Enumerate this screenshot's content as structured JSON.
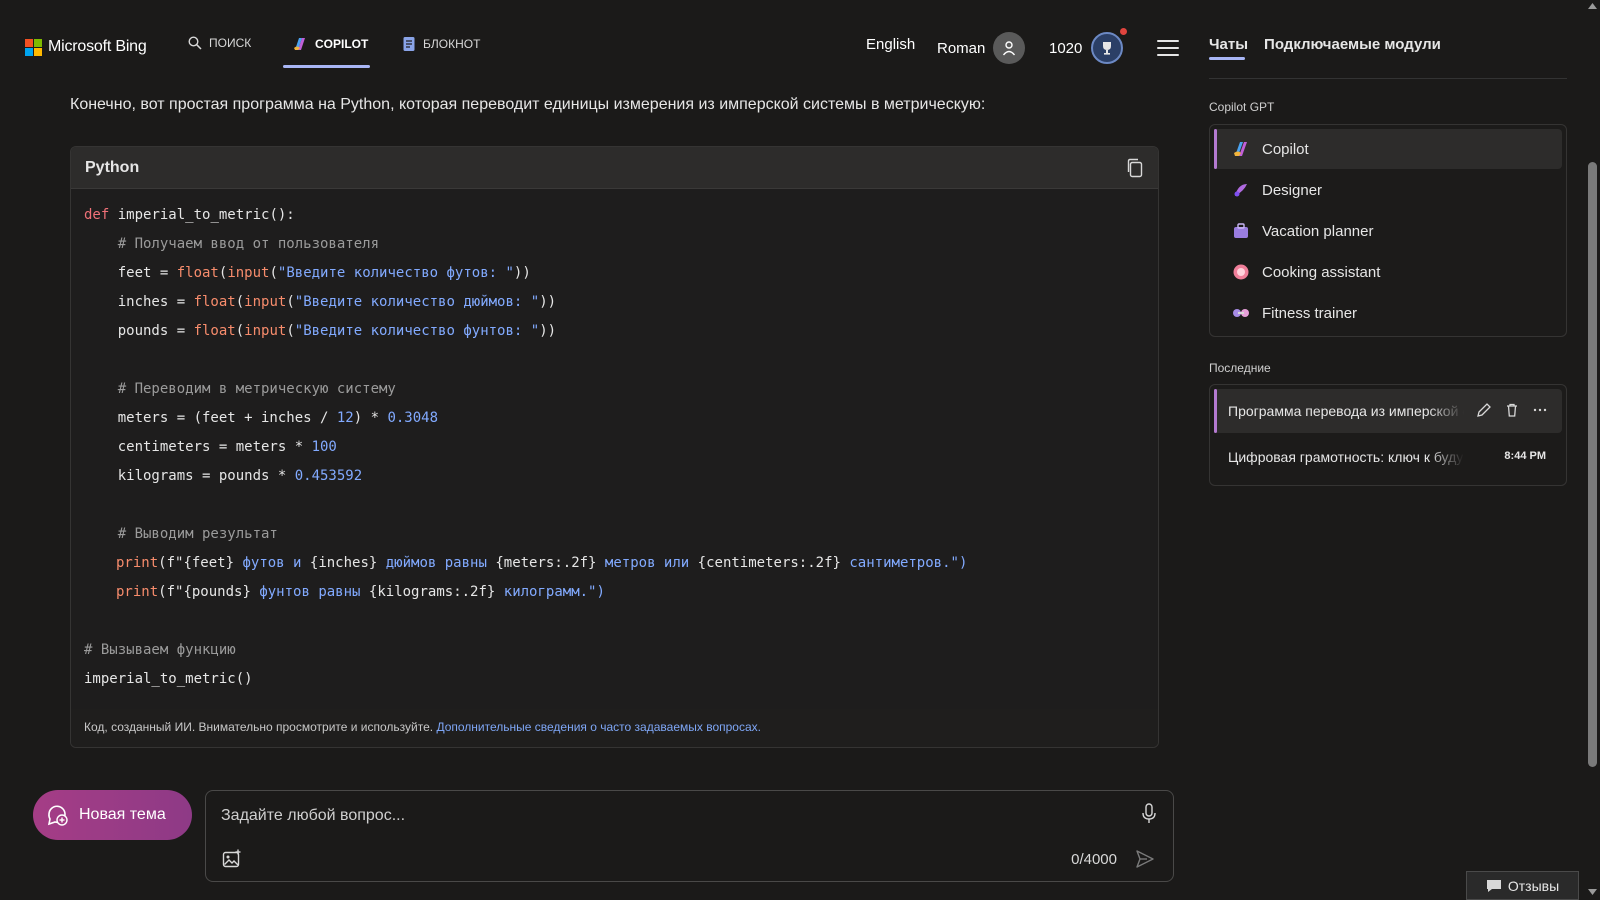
{
  "header": {
    "logo_text": "Microsoft Bing",
    "nav": [
      {
        "label": "ПОИСК",
        "icon": "search-icon"
      },
      {
        "label": "COPILOT",
        "icon": "copilot-icon",
        "active": true
      },
      {
        "label": "БЛОКНОТ",
        "icon": "notebook-icon"
      }
    ],
    "language": "English",
    "user_name": "Roman",
    "points": "1020"
  },
  "chat": {
    "intro_text": "Конечно, вот простая программа на Python, которая переводит единицы измерения из имперской системы в метрическую:",
    "code": {
      "language": "Python",
      "lines": {
        "l1_def": "def",
        "l1_rest": " imperial_to_metric():",
        "l2": "    # Получаем ввод от пользователя",
        "l3_a": "    feet = ",
        "l3_float": "float",
        "l3_b": "(",
        "l3_input": "input",
        "l3_c": "(",
        "l3_str": "\"Введите количество футов: \"",
        "l3_d": "))",
        "l4_a": "    inches = ",
        "l4_str": "\"Введите количество дюймов: \"",
        "l5_a": "    pounds = ",
        "l5_str": "\"Введите количество фунтов: \"",
        "l6": "    # Переводим в метрическую систему",
        "l7_a": "    meters = (feet + inches / ",
        "l7_num1": "12",
        "l7_b": ") * ",
        "l7_num2": "0.3048",
        "l8_a": "    centimeters = meters * ",
        "l8_num": "100",
        "l9_a": "    kilograms = pounds * ",
        "l9_num": "0.453592",
        "l10": "    # Выводим результат",
        "l11_print": "print",
        "l11_a": "(f\"",
        "l11_b": "{feet}",
        "l11_c": " футов и ",
        "l11_d": "{inches}",
        "l11_e": " дюймов равны ",
        "l11_f": "{meters:.2f}",
        "l11_g": " метров или ",
        "l11_h": "{centimeters:.2f}",
        "l11_i": " сантиметров.\")",
        "l12_print": "print",
        "l12_a": "(f\"",
        "l12_b": "{pounds}",
        "l12_c": " фунтов равны ",
        "l12_d": "{kilograms:.2f}",
        "l12_e": " килограмм.\")",
        "l13": "# Вызываем функцию",
        "l14": "imperial_to_metric()"
      },
      "footer_text": "Код, созданный ИИ. Внимательно просмотрите и используйте. ",
      "footer_link": "Дополнительные сведения о часто задаваемых вопросах."
    }
  },
  "composer": {
    "new_topic_label": "Новая тема",
    "placeholder": "Задайте любой вопрос...",
    "counter": "0/4000"
  },
  "sidebar": {
    "tabs": [
      {
        "label": "Чаты",
        "active": true
      },
      {
        "label": "Подключаемые модули"
      }
    ],
    "gpt_section_title": "Copilot GPT",
    "gpts": [
      {
        "label": "Copilot",
        "icon": "copilot-icon",
        "active": true
      },
      {
        "label": "Designer",
        "icon": "designer-icon"
      },
      {
        "label": "Vacation planner",
        "icon": "suitcase-icon"
      },
      {
        "label": "Cooking assistant",
        "icon": "cooking-icon"
      },
      {
        "label": "Fitness trainer",
        "icon": "dumbbell-icon"
      }
    ],
    "recent_section_title": "Последние",
    "recent": [
      {
        "title": "Программа перевода из имперской системы в метрическую",
        "active": true
      },
      {
        "title": "Цифровая грамотность: ключ к будущему",
        "time": "8:44 PM"
      }
    ]
  },
  "feedback_label": "Отзывы",
  "colors": {
    "background": "#1b1a19",
    "accent": "#a9b6f5",
    "new_topic": "#a53d86",
    "link": "#7ea6f5"
  }
}
